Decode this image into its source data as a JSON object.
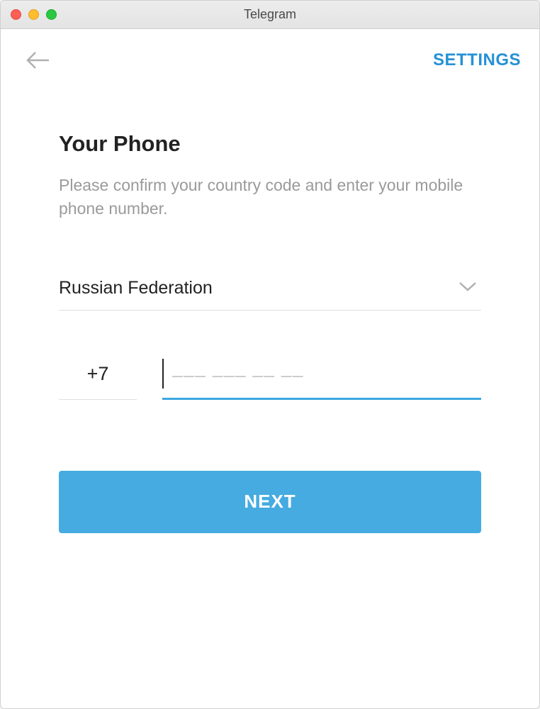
{
  "window": {
    "title": "Telegram"
  },
  "header": {
    "settings_label": "SETTINGS"
  },
  "main": {
    "title": "Your Phone",
    "description": "Please confirm your country code and enter your mobile phone number.",
    "country": {
      "selected": "Russian Federation"
    },
    "phone": {
      "code": "+7",
      "value": "",
      "placeholder": "––– ––– –– ––"
    },
    "next_label": "NEXT"
  }
}
